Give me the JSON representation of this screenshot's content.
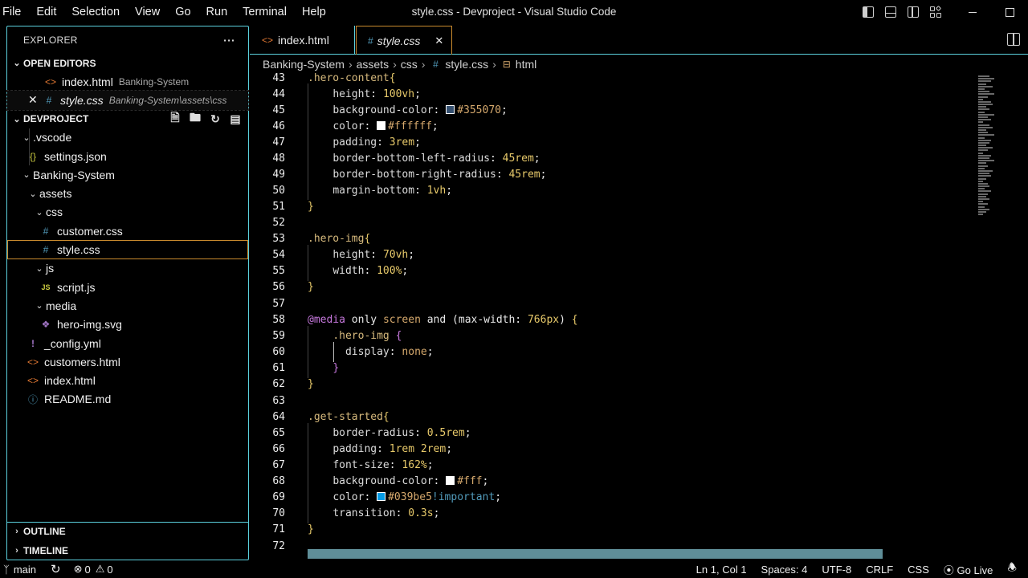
{
  "menu": [
    "File",
    "Edit",
    "Selection",
    "View",
    "Go",
    "Run",
    "Terminal",
    "Help"
  ],
  "window_title": "style.css - Devproject - Visual Studio Code",
  "sidebar": {
    "title": "EXPLORER",
    "more": "···",
    "open_editors": {
      "label": "OPEN EDITORS",
      "items": [
        {
          "name": "index.html",
          "path": "Banking-System",
          "icon": "html-file-icon"
        },
        {
          "name": "style.css",
          "path": "Banking-System\\assets\\css",
          "icon": "css-file-icon"
        }
      ]
    },
    "project": {
      "label": "DEVPROJECT",
      "tree": [
        {
          "label": ".vscode",
          "type": "folder"
        },
        {
          "label": "settings.json",
          "type": "json"
        },
        {
          "label": "Banking-System",
          "type": "folder"
        },
        {
          "label": "assets",
          "type": "folder"
        },
        {
          "label": "css",
          "type": "folder"
        },
        {
          "label": "customer.css",
          "type": "css"
        },
        {
          "label": "style.css",
          "type": "css"
        },
        {
          "label": "js",
          "type": "folder"
        },
        {
          "label": "script.js",
          "type": "js"
        },
        {
          "label": "media",
          "type": "folder"
        },
        {
          "label": "hero-img.svg",
          "type": "svg"
        },
        {
          "label": "_config.yml",
          "type": "yml"
        },
        {
          "label": "customers.html",
          "type": "html"
        },
        {
          "label": "index.html",
          "type": "html"
        },
        {
          "label": "README.md",
          "type": "info"
        }
      ]
    },
    "outline": "OUTLINE",
    "timeline": "TIMELINE"
  },
  "tabs": [
    {
      "label": "index.html",
      "active": false
    },
    {
      "label": "style.css",
      "active": true
    }
  ],
  "breadcrumb": [
    "Banking-System",
    "assets",
    "css",
    "style.css",
    "html"
  ],
  "code": {
    "line_numbers": [
      "43",
      "44",
      "45",
      "46",
      "47",
      "48",
      "49",
      "50",
      "51",
      "52",
      "53",
      "54",
      "55",
      "56",
      "57",
      "58",
      "59",
      "60",
      "61",
      "62",
      "63",
      "64",
      "65",
      "66",
      "67",
      "68",
      "69",
      "70",
      "71",
      "72"
    ]
  },
  "status": {
    "branch": "main",
    "errors": "0",
    "warnings": "0",
    "position": "Ln 1, Col 1",
    "spaces": "Spaces: 4",
    "encoding": "UTF-8",
    "eol": "CRLF",
    "language": "CSS",
    "golive": "Go Live"
  },
  "colors": {
    "accent_border": "#5bd0dd",
    "selected_border": "#c98a2e",
    "swatch_355070": "#355070",
    "swatch_ffffff": "#ffffff",
    "swatch_039be5": "#039be5"
  }
}
